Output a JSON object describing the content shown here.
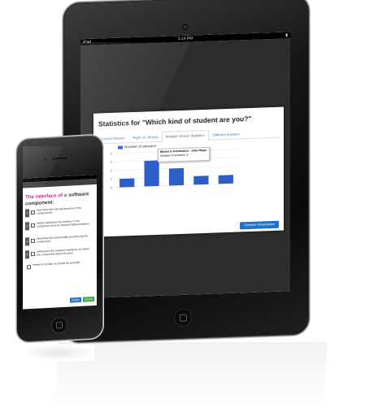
{
  "ipad": {
    "status": {
      "carrier": "iPad",
      "time": "3:14 PM",
      "battery": "▮"
    },
    "stats": {
      "title": "Statistics for \"Which kind of student are you?\"",
      "tabs": [
        "Correct Answer",
        "Right vs. Wrong",
        "Multiple Choice Statistics",
        "Different answers"
      ],
      "active_tab": 2,
      "continue_label": "Continue Presentation"
    }
  },
  "chart_data": {
    "type": "bar",
    "series": [
      {
        "name": "Number of answers",
        "values": [
          1,
          3,
          2,
          1,
          1
        ]
      }
    ],
    "y_ticks": [
      "4",
      "3",
      "2",
      "1",
      "0"
    ],
    "ylim": [
      0,
      4
    ],
    "tooltip": {
      "title": "Master in Informatics - other Major",
      "value": "Number of answers: 3"
    },
    "bar_color": "#2e5fc9"
  },
  "iphone": {
    "question": {
      "part1": "The interface of a ",
      "part2": "software component",
      "part3": ":"
    },
    "options": [
      {
        "num": "1",
        "text": "describes the internal features of the component's"
      },
      {
        "num": "2",
        "text": "clearly separates the surface of the component from its internal implementation"
      },
      {
        "num": "3",
        "text": "describes the functionality provided by the component"
      },
      {
        "num": "4",
        "text": "references the required interfaces on which the component depends upon"
      },
      {
        "num": "",
        "text": "needs to be kept as simple as possible"
      }
    ],
    "modify_label": "Modify",
    "submit_label": "Submit"
  },
  "colors": {
    "accent_pink": "#d81b7e",
    "button_blue": "#1f72c9",
    "button_green": "#46a047"
  }
}
